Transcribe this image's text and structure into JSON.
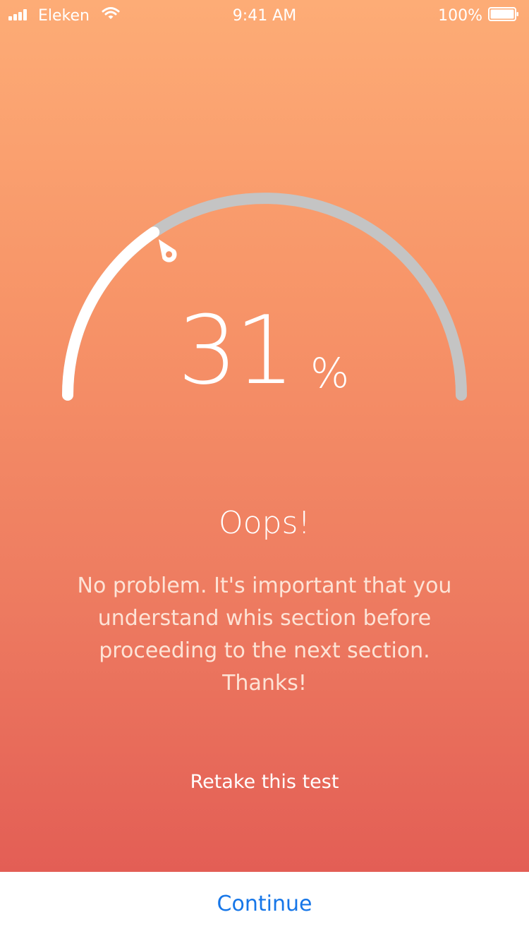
{
  "status_bar": {
    "carrier": "Eleken",
    "time": "9:41 AM",
    "battery": "100%",
    "icons": [
      "signal-icon",
      "wifi-icon",
      "battery-icon"
    ]
  },
  "result": {
    "percent_value": "31",
    "percent_sign": "%",
    "progress_fraction": 0.31,
    "headline": "Oops!",
    "message": "No problem. It's important that you understand whis section before proceeding to the next section. Thanks!"
  },
  "actions": {
    "retake_label": "Retake this test",
    "continue_label": "Continue"
  },
  "colors": {
    "gradient_top": "#fdac76",
    "gradient_bottom": "#e35e55",
    "track": "#c4c4c4",
    "progress": "#ffffff",
    "continue_text": "#1676e8"
  }
}
